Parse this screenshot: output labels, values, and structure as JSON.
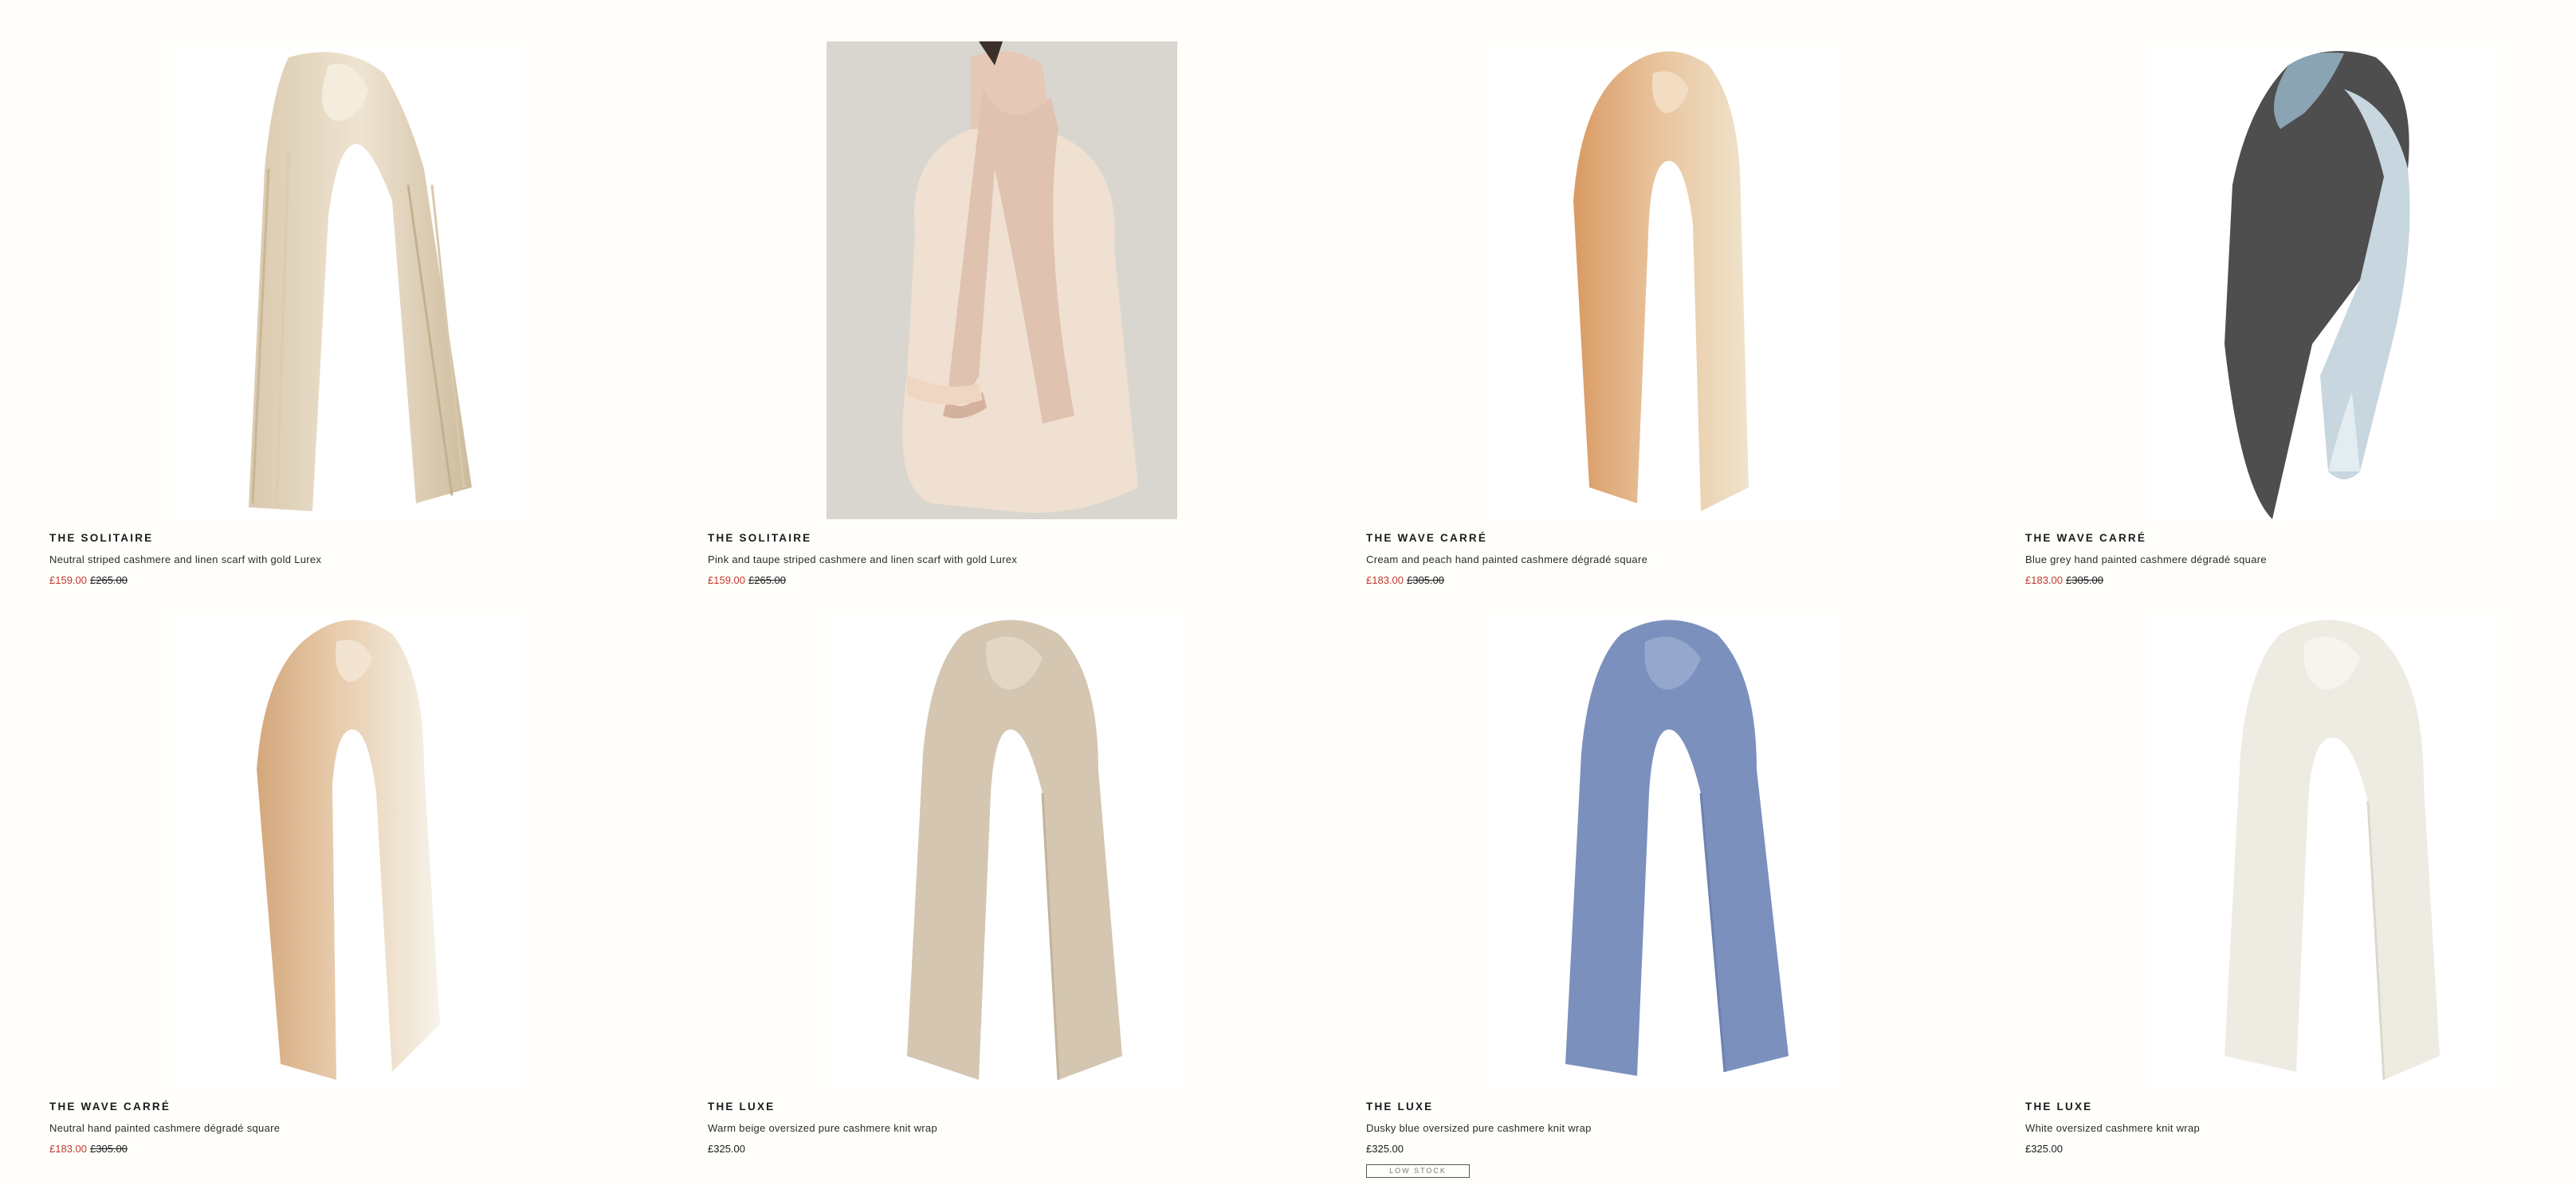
{
  "products": [
    {
      "collection": "THE SOLITAIRE",
      "description": "Neutral striped cashmere and linen scarf with gold Lurex",
      "price_sale": "£159.00",
      "price_was": "£265.00",
      "price": "",
      "badge": "",
      "image": "neutral-striped-scarf-image"
    },
    {
      "collection": "THE SOLITAIRE",
      "description": "Pink and taupe striped cashmere and linen scarf with gold Lurex",
      "price_sale": "£159.00",
      "price_was": "£265.00",
      "price": "",
      "badge": "",
      "image": "model-wearing-pink-scarf-image"
    },
    {
      "collection": "THE WAVE CARRÉ",
      "description": "Cream and peach hand painted cashmere dégradé square",
      "price_sale": "£183.00",
      "price_was": "£305.00",
      "price": "",
      "badge": "",
      "image": "cream-peach-scarf-image"
    },
    {
      "collection": "THE WAVE CARRÉ",
      "description": "Blue grey hand painted cashmere dégradé square",
      "price_sale": "£183.00",
      "price_was": "£305.00",
      "price": "",
      "badge": "",
      "image": "blue-grey-scarf-image"
    },
    {
      "collection": "THE WAVE CARRÉ",
      "description": "Neutral hand painted cashmere dégradé square",
      "price_sale": "£183.00",
      "price_was": "£305.00",
      "price": "",
      "badge": "",
      "image": "neutral-degrade-scarf-image"
    },
    {
      "collection": "THE LUXE",
      "description": "Warm beige oversized pure cashmere knit wrap",
      "price_sale": "",
      "price_was": "",
      "price": "£325.00",
      "badge": "",
      "image": "warm-beige-wrap-image"
    },
    {
      "collection": "THE LUXE",
      "description": "Dusky blue oversized pure cashmere knit wrap",
      "price_sale": "",
      "price_was": "",
      "price": "£325.00",
      "badge": "LOW STOCK",
      "image": "dusky-blue-wrap-image"
    },
    {
      "collection": "THE LUXE",
      "description": "White oversized cashmere knit wrap",
      "price_sale": "",
      "price_was": "",
      "price": "£325.00",
      "badge": "",
      "image": "white-wrap-image"
    }
  ],
  "colors": {
    "page_background": "#fffefb",
    "sale_red": "#c0392b",
    "text": "#1a1a1a"
  }
}
